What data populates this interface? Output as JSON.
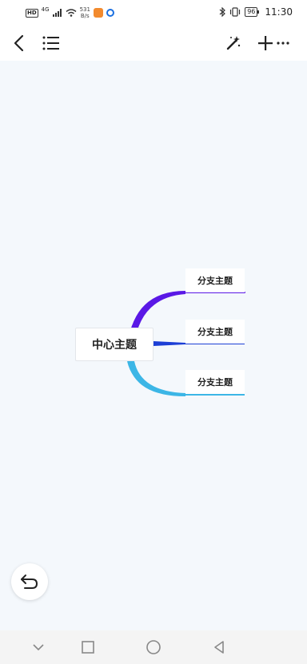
{
  "status_bar": {
    "net_badge": "HD",
    "net_type": "4G",
    "speed_value": "531",
    "speed_unit": "B/s",
    "battery": "96",
    "time": "11:30"
  },
  "toolbar": {
    "back_icon": "chevron-left-icon",
    "outline_icon": "list-icon",
    "style_icon": "magic-wand-icon",
    "add_icon": "plus-icon",
    "more_icon": "more-icon"
  },
  "mindmap": {
    "center_topic": "中心主题",
    "branches": [
      {
        "label": "分支主题",
        "color": "#5a18e6"
      },
      {
        "label": "分支主题",
        "color": "#1c3fd6"
      },
      {
        "label": "分支主题",
        "color": "#3cb6e6"
      }
    ]
  },
  "undo": {
    "icon": "undo-icon"
  },
  "nav_bar": {
    "icons": [
      "chevron-down-icon",
      "square-icon",
      "circle-icon",
      "triangle-back-icon"
    ]
  }
}
